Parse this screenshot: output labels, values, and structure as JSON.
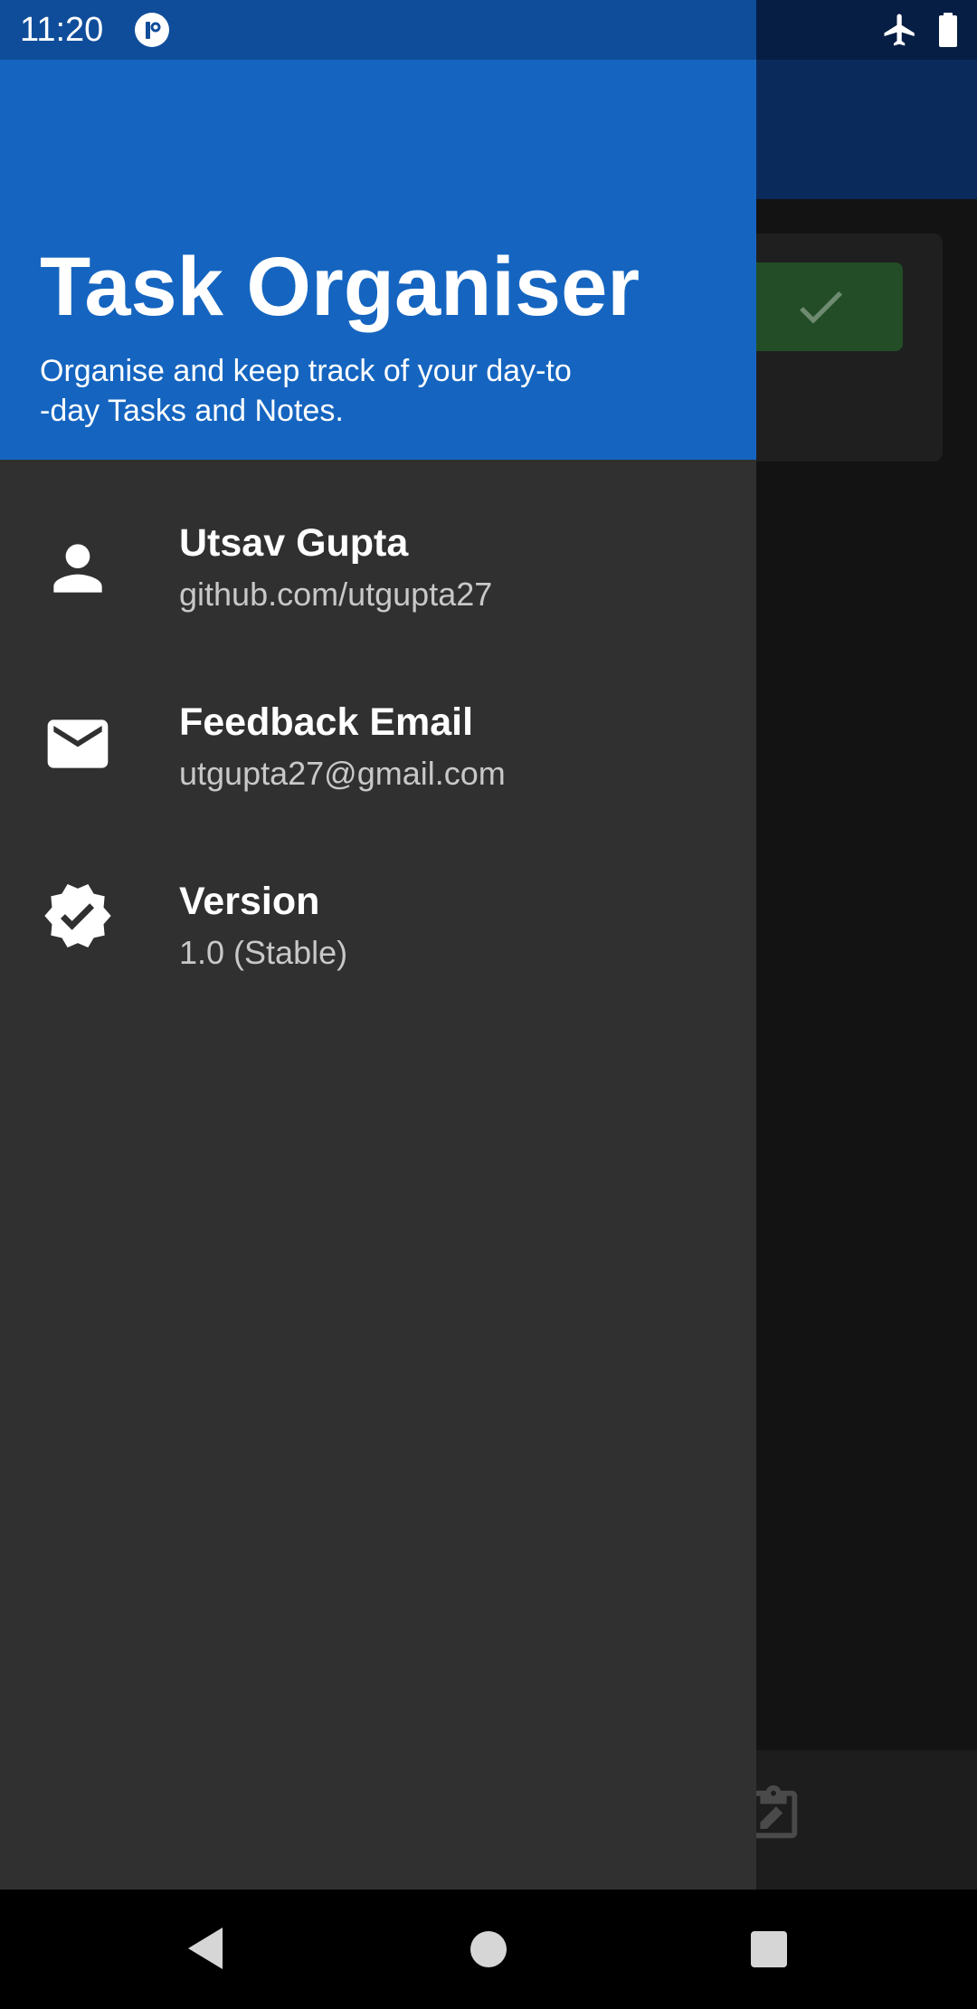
{
  "status_bar": {
    "time": "11:20",
    "icons": [
      "app-notification-icon",
      "airplane-mode-icon",
      "battery-icon"
    ]
  },
  "drawer": {
    "header": {
      "title": "Task Organiser",
      "subtitle_line1": "Organise and keep track of your day-to",
      "subtitle_line2": "-day Tasks and Notes."
    },
    "items": [
      {
        "icon": "person-icon",
        "title": "Utsav Gupta",
        "subtitle": "github.com/utgupta27"
      },
      {
        "icon": "mail-icon",
        "title": "Feedback Email",
        "subtitle": "utgupta27@gmail.com"
      },
      {
        "icon": "verified-badge-icon",
        "title": "Version",
        "subtitle": "1.0 (Stable)"
      }
    ]
  },
  "background_app": {
    "done_button_icon": "check-icon",
    "bottom_bar_icon": "edit-note-icon"
  },
  "nav_bar": {
    "icons": [
      "back-icon",
      "home-icon",
      "recents-icon"
    ]
  },
  "colors": {
    "header_blue": "#1565c0",
    "drawer_bg": "#303030",
    "status_bar": "#0f4d9a",
    "done_green": "#2e7d32"
  }
}
